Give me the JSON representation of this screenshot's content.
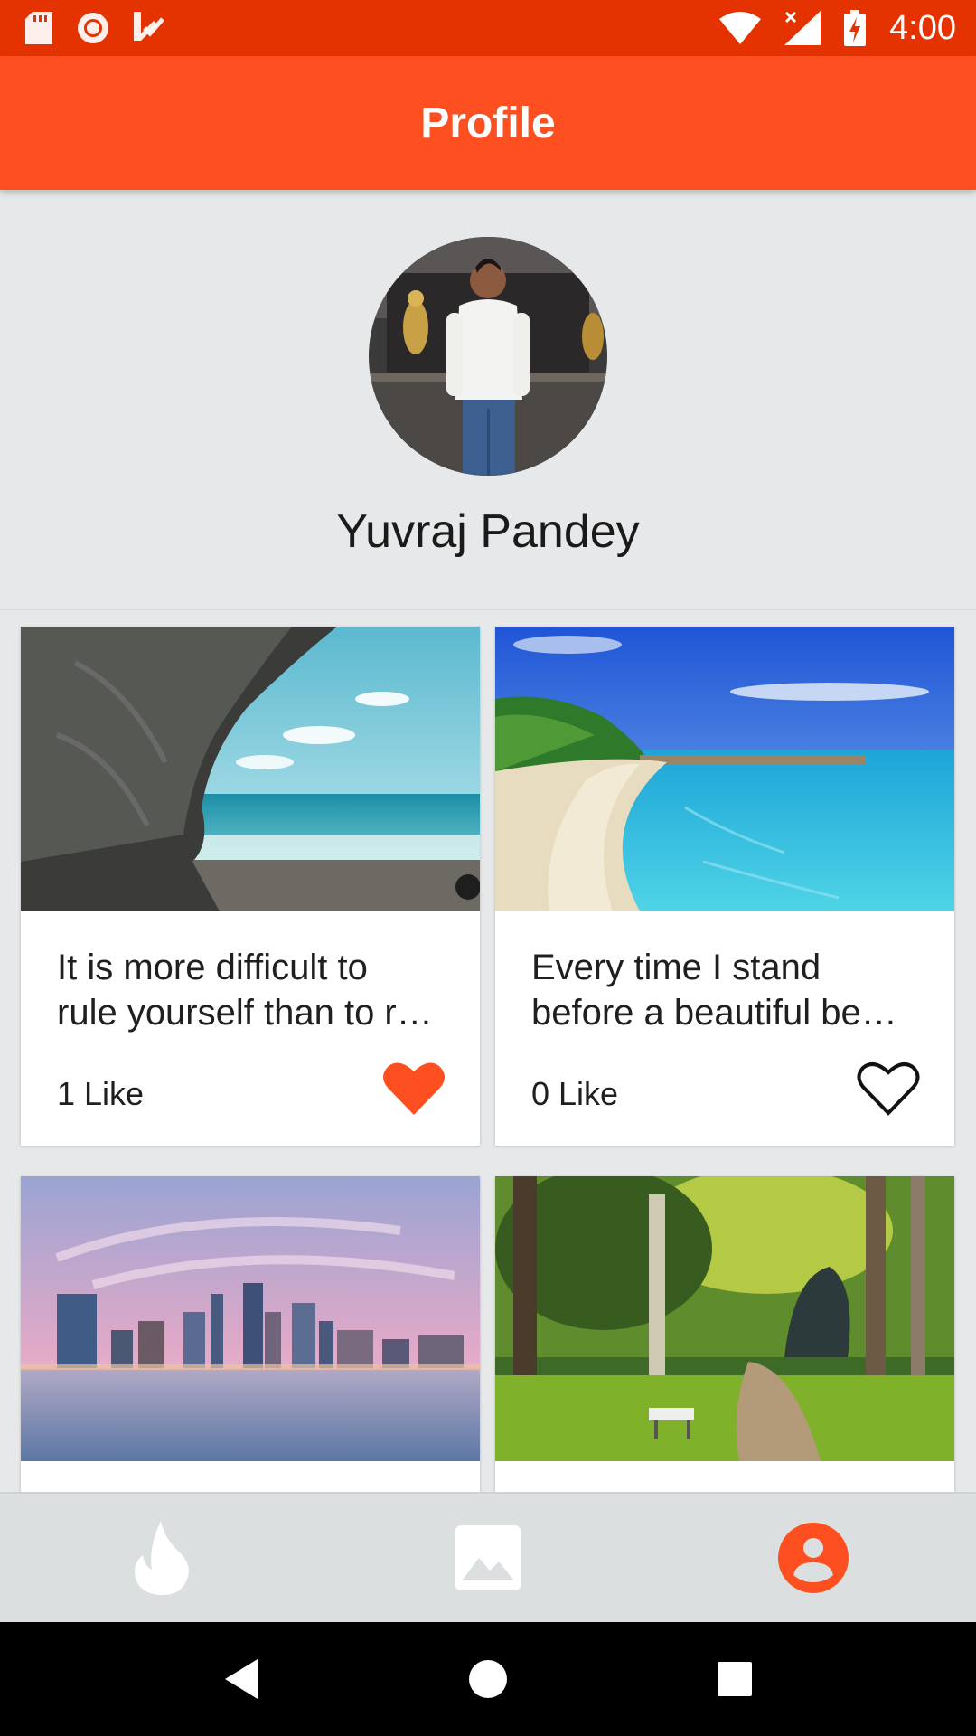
{
  "status_bar": {
    "time": "4:00",
    "icons_left": [
      "sd-card-icon",
      "circle-record-icon",
      "download-check-icon"
    ],
    "icons_right": [
      "wifi-icon",
      "signal-no-data-icon",
      "battery-charging-icon"
    ]
  },
  "app_bar": {
    "title": "Profile"
  },
  "profile": {
    "name": "Yuvraj Pandey"
  },
  "cards": [
    {
      "text": "It is more difficult to\nrule yourself than to r…",
      "likes": "1 Like",
      "liked": true
    },
    {
      "text": "Every time I stand\nbefore a beautiful be…",
      "likes": "0 Like",
      "liked": false
    },
    {
      "text": "",
      "likes": "",
      "liked": false
    },
    {
      "text": "",
      "likes": "",
      "liked": false
    }
  ],
  "bottom_nav": {
    "items": [
      {
        "icon": "fire-icon",
        "active": false
      },
      {
        "icon": "image-icon",
        "active": false
      },
      {
        "icon": "account-icon",
        "active": true
      }
    ]
  },
  "colors": {
    "status_bar": "#e43300",
    "app_bar": "#fd4f1f",
    "accent": "#fd4f1f",
    "background": "#e6e8e9"
  }
}
